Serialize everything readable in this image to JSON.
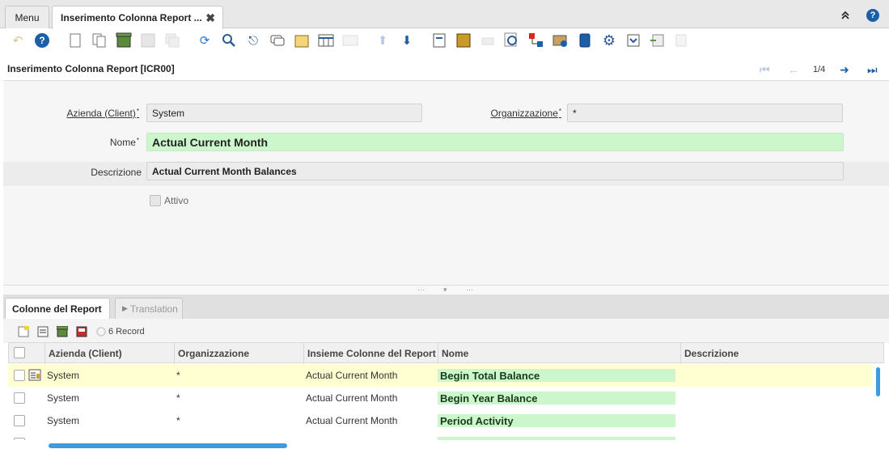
{
  "tabs": {
    "menu_label": "Menu",
    "active_label": "Inserimento Colonna Report ...",
    "close_glyph": "✖"
  },
  "header": {
    "title": "Inserimento Colonna Report [ICR00]",
    "record_position": "1/4"
  },
  "form": {
    "client_label": "Azienda (Client)",
    "client_value": "System",
    "org_label": "Organizzazione",
    "org_value": "*",
    "name_label": "Nome",
    "name_value": "Actual Current Month",
    "description_label": "Descrizione",
    "description_value": "Actual Current Month Balances",
    "active_label": "Attivo",
    "required_mark": "*"
  },
  "lower_tabs": {
    "active_label": "Colonne del Report",
    "inactive_label": "Translation"
  },
  "grid": {
    "record_count": "6 Record",
    "columns": [
      "Azienda (Client)",
      "Organizzazione",
      "Insieme Colonne del Report",
      "Nome",
      "Descrizione"
    ],
    "rows": [
      {
        "client": "System",
        "org": "*",
        "set": "Actual Current Month",
        "name": "Begin Total Balance",
        "desc": ""
      },
      {
        "client": "System",
        "org": "*",
        "set": "Actual Current Month",
        "name": "Begin Year Balance",
        "desc": ""
      },
      {
        "client": "System",
        "org": "*",
        "set": "Actual Current Month",
        "name": "Period Activity",
        "desc": ""
      }
    ]
  },
  "colors": {
    "accent": "#1c5fa8",
    "mandatory_field": "#ccf7cc",
    "selected_row": "#ffffd2",
    "scrollbar": "#3f9be0"
  }
}
